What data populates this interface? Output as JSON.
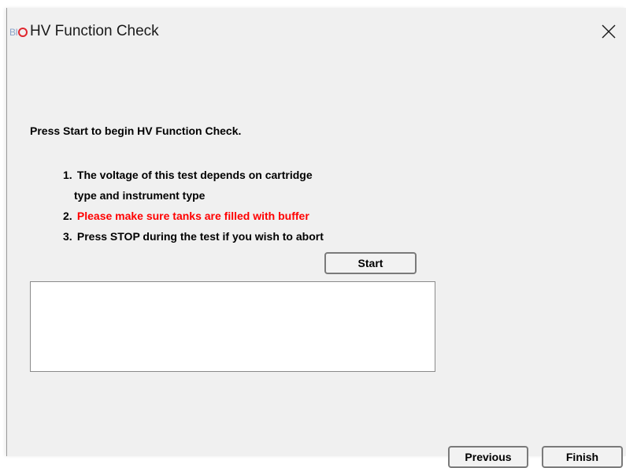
{
  "window": {
    "title": "HV Function Check",
    "logo_text": "BI",
    "close_icon": "close-icon"
  },
  "main": {
    "intro": "Press Start to begin HV Function Check.",
    "steps": [
      {
        "number": "1.",
        "text": "The voltage of this test depends on cartridge",
        "continuation": "type and instrument type",
        "color": "#000000"
      },
      {
        "number": "2.",
        "text": "Please make sure tanks are filled with buffer",
        "color": "#ff0000"
      },
      {
        "number": "3.",
        "text": "Press STOP during the test if you wish to abort",
        "color": "#000000"
      }
    ],
    "start_label": "Start",
    "output_text": ""
  },
  "footer": {
    "previous_label": "Previous",
    "finish_label": "Finish"
  },
  "colors": {
    "warning": "#ff0000",
    "logo_ring": "#e0262e",
    "logo_text": "#8aa3c8"
  }
}
